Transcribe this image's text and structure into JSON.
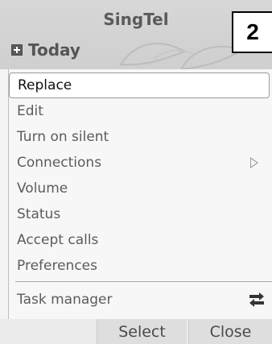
{
  "header": {
    "operator": "SingTel",
    "today_label": "Today",
    "badge": "2"
  },
  "menu": {
    "items": [
      {
        "label": "Replace",
        "selected": true
      },
      {
        "label": "Edit"
      },
      {
        "label": "Turn on silent"
      },
      {
        "label": "Connections",
        "submenu": true
      },
      {
        "label": "Volume"
      },
      {
        "label": "Status"
      },
      {
        "label": "Accept calls"
      },
      {
        "label": "Preferences"
      }
    ],
    "task_manager": "Task manager"
  },
  "softkeys": {
    "select": "Select",
    "close": "Close"
  }
}
